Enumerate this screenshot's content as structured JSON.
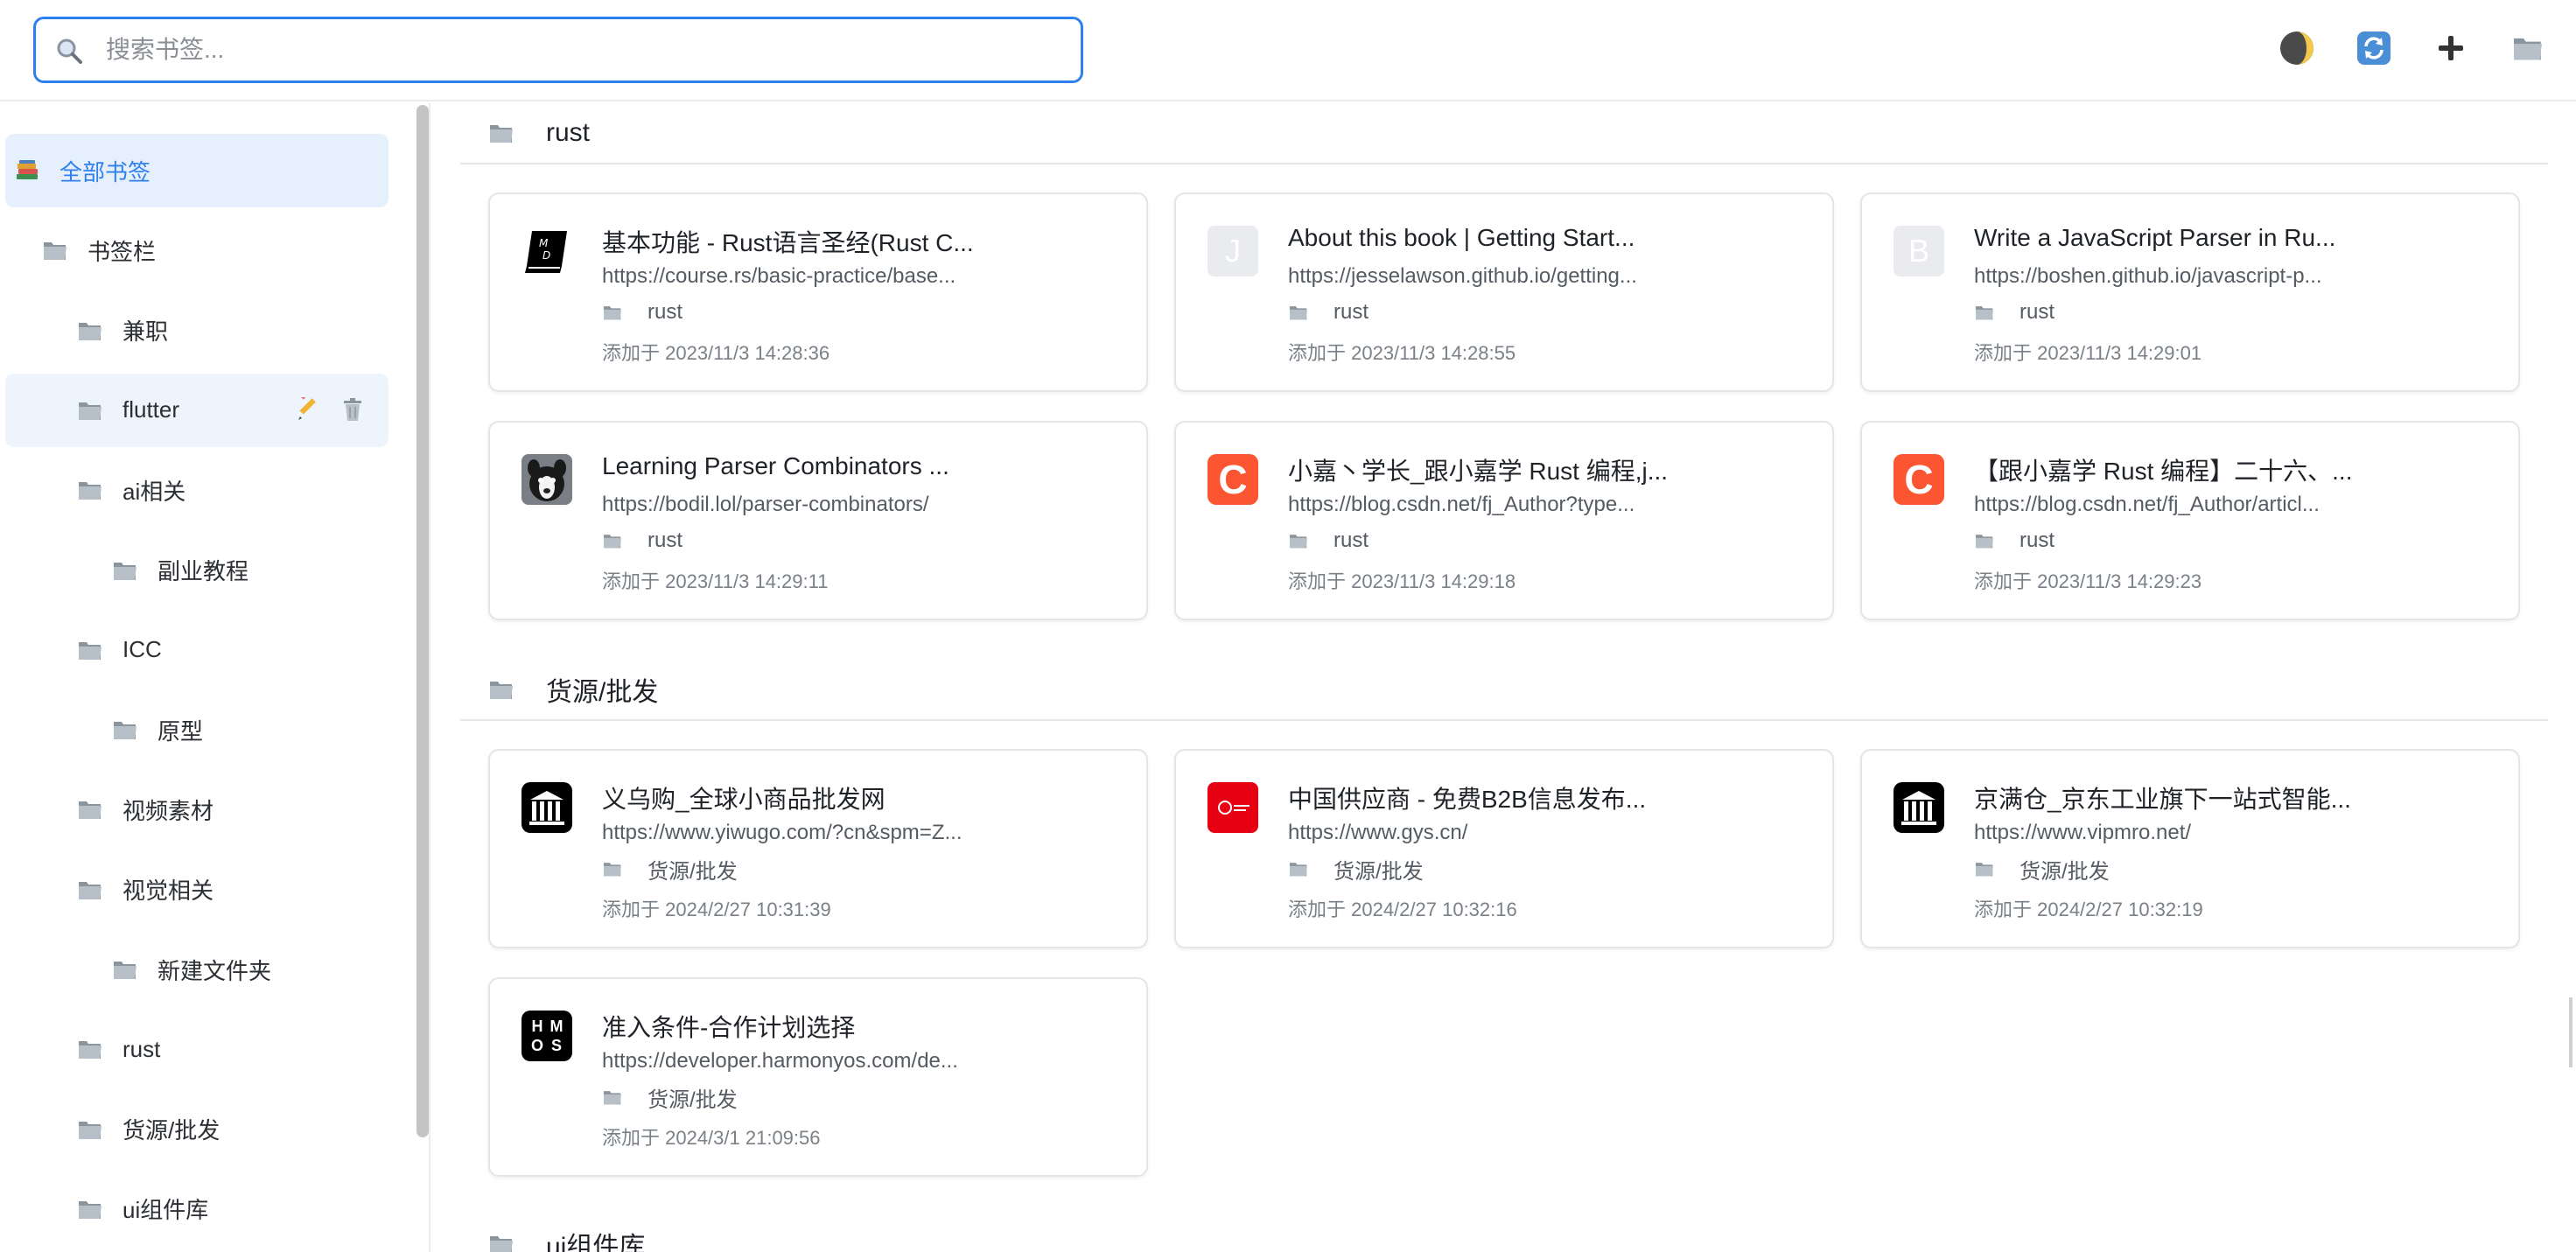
{
  "search": {
    "placeholder": "搜索书签..."
  },
  "header": {
    "buttons": [
      {
        "name": "theme-toggle-button",
        "icon": "moon-icon"
      },
      {
        "name": "sync-button",
        "icon": "refresh-icon"
      },
      {
        "name": "add-button",
        "icon": "plus-icon"
      },
      {
        "name": "folder-button",
        "icon": "folder-icon"
      }
    ]
  },
  "sidebar": {
    "items": [
      {
        "label": "全部书签",
        "depth": 0,
        "icon": "books-icon",
        "active": true
      },
      {
        "label": "书签栏",
        "depth": 1,
        "icon": "folder-icon"
      },
      {
        "label": "兼职",
        "depth": 2,
        "icon": "folder-icon"
      },
      {
        "label": "flutter",
        "depth": 2,
        "icon": "folder-icon",
        "hover": true
      },
      {
        "label": "ai相关",
        "depth": 2,
        "icon": "folder-icon"
      },
      {
        "label": "副业教程",
        "depth": 3,
        "icon": "folder-icon"
      },
      {
        "label": "ICC",
        "depth": 2,
        "icon": "folder-icon"
      },
      {
        "label": "原型",
        "depth": 3,
        "icon": "folder-icon"
      },
      {
        "label": "视频素材",
        "depth": 2,
        "icon": "folder-icon"
      },
      {
        "label": "视觉相关",
        "depth": 2,
        "icon": "folder-icon"
      },
      {
        "label": "新建文件夹",
        "depth": 3,
        "icon": "folder-icon"
      },
      {
        "label": "rust",
        "depth": 2,
        "icon": "folder-icon"
      },
      {
        "label": "货源/批发",
        "depth": 2,
        "icon": "folder-icon"
      },
      {
        "label": "ui组件库",
        "depth": 2,
        "icon": "folder-icon"
      }
    ]
  },
  "colors": {
    "accent": "#2f80ed",
    "active_bg": "#e6f0fd",
    "csdn": "#fc5531",
    "gys": "#e60012"
  },
  "sections": [
    {
      "title": "rust",
      "bookmarks": [
        {
          "title": "基本功能 - Rust语言圣经(Rust C...",
          "url": "https://course.rs/basic-practice/base...",
          "folder": "rust",
          "date": "添加于 2023/11/3 14:28:36",
          "favicon": "md-book"
        },
        {
          "title": "About this book | Getting Start...",
          "url": "https://jesselawson.github.io/getting...",
          "folder": "rust",
          "date": "添加于 2023/11/3 14:28:55",
          "favicon": "letter",
          "letter": "J"
        },
        {
          "title": "Write a JavaScript Parser in Ru...",
          "url": "https://boshen.github.io/javascript-p...",
          "folder": "rust",
          "date": "添加于 2023/11/3 14:29:01",
          "favicon": "letter",
          "letter": "B"
        },
        {
          "title": "Learning Parser Combinators ...",
          "url": "https://bodil.lol/parser-combinators/",
          "folder": "rust",
          "date": "添加于 2023/11/3 14:29:11",
          "favicon": "dog"
        },
        {
          "title": "小嘉丶学长_跟小嘉学 Rust 编程,j...",
          "url": "https://blog.csdn.net/fj_Author?type...",
          "folder": "rust",
          "date": "添加于 2023/11/3 14:29:18",
          "favicon": "csdn",
          "letter": "C"
        },
        {
          "title": "【跟小嘉学 Rust 编程】二十六、...",
          "url": "https://blog.csdn.net/fj_Author/articl...",
          "folder": "rust",
          "date": "添加于 2023/11/3 14:29:23",
          "favicon": "csdn",
          "letter": "C"
        }
      ]
    },
    {
      "title": "货源/批发",
      "bookmarks": [
        {
          "title": "义乌购_全球小商品批发网",
          "url": "https://www.yiwugo.com/?cn&spm=Z...",
          "folder": "货源/批发",
          "date": "添加于 2024/2/27 10:31:39",
          "favicon": "pillars"
        },
        {
          "title": "中国供应商 - 免费B2B信息发布...",
          "url": "https://www.gys.cn/",
          "folder": "货源/批发",
          "date": "添加于 2024/2/27 10:32:16",
          "favicon": "gys"
        },
        {
          "title": "京满仓_京东工业旗下一站式智能...",
          "url": "https://www.vipmro.net/",
          "folder": "货源/批发",
          "date": "添加于 2024/2/27 10:32:19",
          "favicon": "pillars"
        },
        {
          "title": "准入条件-合作计划选择",
          "url": "https://developer.harmonyos.com/de...",
          "folder": "货源/批发",
          "date": "添加于 2024/3/1 21:09:56",
          "favicon": "hmos",
          "letters": [
            "H",
            "M",
            "O",
            "S"
          ]
        }
      ]
    },
    {
      "title": "ui组件库",
      "bookmarks": []
    }
  ]
}
